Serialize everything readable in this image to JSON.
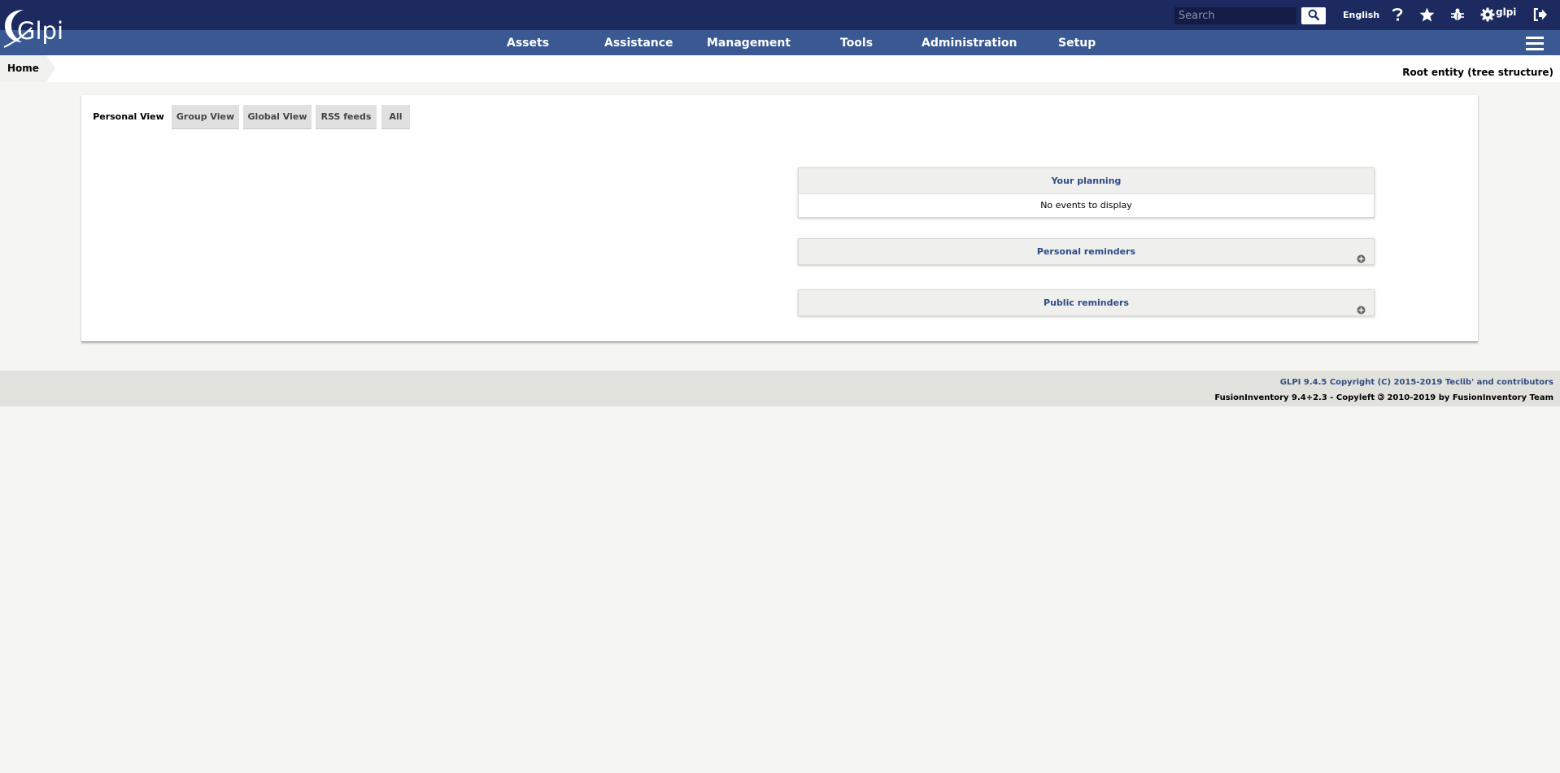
{
  "header": {
    "logo_text": "Glpi",
    "search": {
      "placeholder": "Search",
      "value": ""
    },
    "language": "English",
    "user": "glpi"
  },
  "nav": {
    "items": [
      {
        "label": "Assets"
      },
      {
        "label": "Assistance"
      },
      {
        "label": "Management"
      },
      {
        "label": "Tools"
      },
      {
        "label": "Administration"
      },
      {
        "label": "Setup"
      }
    ]
  },
  "breadcrumb": {
    "home": "Home"
  },
  "entity": "Root entity (tree structure)",
  "tabs": [
    {
      "label": "Personal View",
      "active": true
    },
    {
      "label": "Group View"
    },
    {
      "label": "Global View"
    },
    {
      "label": "RSS feeds"
    },
    {
      "label": "All"
    }
  ],
  "planning": {
    "title": "Your planning",
    "empty": "No events to display"
  },
  "personal_reminders": {
    "title": "Personal reminders"
  },
  "public_reminders": {
    "title": "Public reminders"
  },
  "footer": {
    "line1": "GLPI 9.4.5 Copyright (C) 2015-2019 Teclib' and contributors",
    "line2": "FusionInventory 9.4+2.3 - Copyleft 🄯 2010-2019 by FusionInventory Team"
  },
  "colors": {
    "header": "#1c2a5f",
    "nav": "#3a5993",
    "accent": "#2f4b85",
    "background": "#f5f5f1"
  }
}
